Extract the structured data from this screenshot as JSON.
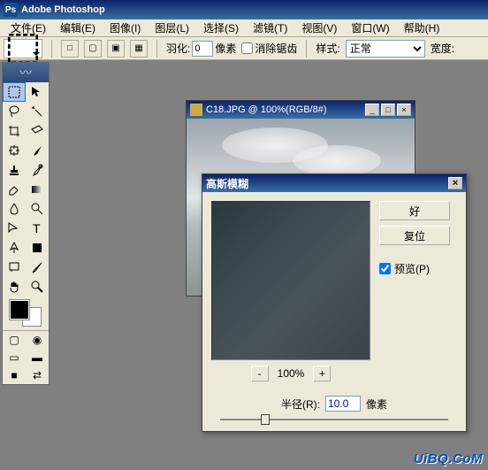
{
  "app": {
    "title": "Adobe Photoshop"
  },
  "menu": {
    "file": "文件(E)",
    "edit": "编辑(E)",
    "image": "图像(I)",
    "layer": "图层(L)",
    "select": "选择(S)",
    "filter": "滤镜(T)",
    "view": "视图(V)",
    "window": "窗口(W)",
    "help": "帮助(H)"
  },
  "options": {
    "feather_label": "羽化:",
    "feather_value": "0",
    "pixels": "像素",
    "antialias": "消除锯齿",
    "style_label": "样式:",
    "style_value": "正常",
    "width_label": "宽度:"
  },
  "document": {
    "title": "C18.JPG @ 100%(RGB/8#)"
  },
  "dialog": {
    "title": "高斯模糊",
    "ok": "好",
    "reset": "复位",
    "preview": "预览(P)",
    "zoom": "100%",
    "radius_label": "半径(R):",
    "radius_value": "10.0",
    "radius_unit": "像素"
  },
  "watermark": "UiBQ.CoM"
}
